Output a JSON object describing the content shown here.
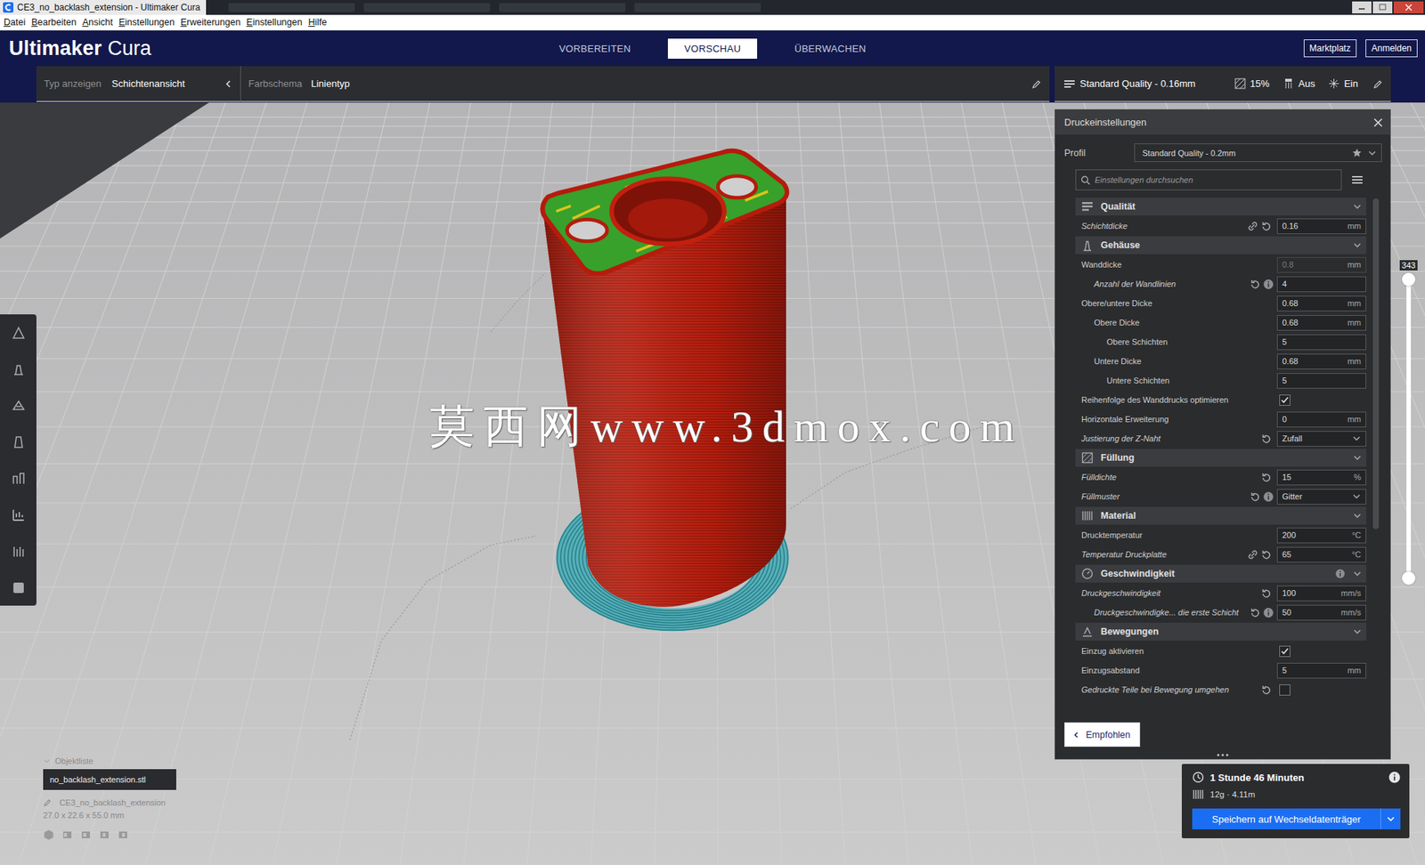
{
  "window": {
    "title": "CE3_no_backlash_extension - Ultimaker Cura"
  },
  "menu": [
    "Datei",
    "Bearbeiten",
    "Ansicht",
    "Einstellungen",
    "Erweiterungen",
    "Einstellungen",
    "Hilfe"
  ],
  "logo": {
    "brand": "Ultimaker",
    "product": "Cura"
  },
  "stages": [
    {
      "label": "VORBEREITEN",
      "selected": false
    },
    {
      "label": "VORSCHAU",
      "selected": true
    },
    {
      "label": "ÜBERWACHEN",
      "selected": false
    }
  ],
  "header_buttons": [
    "Marktplatz",
    "Anmelden"
  ],
  "view_bar": {
    "type_label": "Typ anzeigen",
    "type_value": "Schichtenansicht",
    "scheme_label": "Farbschema",
    "scheme_value": "Linientyp"
  },
  "print_setup": {
    "profile": "Standard Quality - 0.16mm",
    "infill": "15%",
    "support": "Aus",
    "adhesion": "Ein"
  },
  "watermark": "莫西网www.3dmox.com",
  "layer_slider": {
    "value": "343",
    "level": 1
  },
  "settings": {
    "title": "Druckeinstellungen",
    "profile_label": "Profil",
    "profile_value": "Standard Quality - 0.2mm",
    "search_placeholder": "Einstellungen durchsuchen",
    "button": "Empfohlen",
    "rows": [
      {
        "kind": "category",
        "label": "Qualität",
        "expanded": true,
        "info": false
      },
      {
        "kind": "number",
        "label": "Schichtdicke",
        "value": "0.16",
        "unit": "mm",
        "depth": 0,
        "changed": true,
        "linked": true,
        "resettable": true,
        "info": false,
        "disabled": false
      },
      {
        "kind": "category",
        "label": "Gehäuse",
        "expanded": true,
        "info": false
      },
      {
        "kind": "number",
        "label": "Wanddicke",
        "value": "0.8",
        "unit": "mm",
        "depth": 0,
        "changed": false,
        "linked": false,
        "resettable": false,
        "info": false,
        "disabled": true
      },
      {
        "kind": "number",
        "label": "Anzahl der Wandlinien",
        "value": "4",
        "depth": 1,
        "changed": true,
        "linked": false,
        "resettable": true,
        "info": true,
        "disabled": false
      },
      {
        "kind": "number",
        "label": "Obere/untere Dicke",
        "value": "0.68",
        "unit": "mm",
        "depth": 0,
        "changed": false,
        "linked": false,
        "resettable": false,
        "info": false,
        "disabled": false
      },
      {
        "kind": "number",
        "label": "Obere Dicke",
        "value": "0.68",
        "unit": "mm",
        "depth": 1,
        "changed": false,
        "linked": false,
        "resettable": false,
        "info": false,
        "disabled": false
      },
      {
        "kind": "number",
        "label": "Obere Schichten",
        "value": "5",
        "depth": 2,
        "changed": false,
        "linked": false,
        "resettable": false,
        "info": false,
        "disabled": false
      },
      {
        "kind": "number",
        "label": "Untere Dicke",
        "value": "0.68",
        "unit": "mm",
        "depth": 1,
        "changed": false,
        "linked": false,
        "resettable": false,
        "info": false,
        "disabled": false
      },
      {
        "kind": "number",
        "label": "Untere Schichten",
        "value": "5",
        "depth": 2,
        "changed": false,
        "linked": false,
        "resettable": false,
        "info": false,
        "disabled": false
      },
      {
        "kind": "checkbox",
        "label": "Reihenfolge des Wanddrucks optimieren",
        "checked": true,
        "depth": 0,
        "changed": false,
        "linked": false,
        "resettable": false,
        "info": false
      },
      {
        "kind": "number",
        "label": "Horizontale Erweiterung",
        "value": "0",
        "unit": "mm",
        "depth": 0,
        "changed": false,
        "linked": false,
        "resettable": false,
        "info": false,
        "disabled": false
      },
      {
        "kind": "dropdown",
        "label": "Justierung der Z-Naht",
        "value": "Zufall",
        "depth": 0,
        "changed": true,
        "linked": false,
        "resettable": true,
        "info": false
      },
      {
        "kind": "category",
        "label": "Füllung",
        "expanded": true,
        "info": false
      },
      {
        "kind": "number",
        "label": "Fülldichte",
        "value": "15",
        "unit": "%",
        "depth": 0,
        "changed": true,
        "linked": false,
        "resettable": true,
        "info": false,
        "disabled": false
      },
      {
        "kind": "dropdown",
        "label": "Füllmuster",
        "value": "Gitter",
        "depth": 0,
        "changed": true,
        "linked": false,
        "resettable": true,
        "info": true
      },
      {
        "kind": "category",
        "label": "Material",
        "expanded": true,
        "info": false
      },
      {
        "kind": "number",
        "label": "Drucktemperatur",
        "value": "200",
        "unit": "°C",
        "depth": 0,
        "changed": false,
        "linked": false,
        "resettable": false,
        "info": false,
        "disabled": false
      },
      {
        "kind": "number",
        "label": "Temperatur Druckplatte",
        "value": "65",
        "unit": "°C",
        "depth": 0,
        "changed": true,
        "linked": true,
        "resettable": true,
        "info": false,
        "disabled": false
      },
      {
        "kind": "category",
        "label": "Geschwindigkeit",
        "expanded": true,
        "info": true
      },
      {
        "kind": "number",
        "label": "Druckgeschwindigkeit",
        "value": "100",
        "unit": "mm/s",
        "depth": 0,
        "changed": true,
        "linked": false,
        "resettable": true,
        "info": false,
        "disabled": false
      },
      {
        "kind": "number",
        "label": "Druckgeschwindigke... die erste Schicht",
        "value": "50",
        "unit": "mm/s",
        "depth": 1,
        "changed": true,
        "linked": false,
        "resettable": true,
        "info": true,
        "disabled": false
      },
      {
        "kind": "category",
        "label": "Bewegungen",
        "expanded": true,
        "info": false
      },
      {
        "kind": "checkbox",
        "label": "Einzug aktivieren",
        "checked": true,
        "depth": 0,
        "changed": false,
        "linked": false,
        "resettable": false,
        "info": false
      },
      {
        "kind": "number",
        "label": "Einzugsabstand",
        "value": "5",
        "unit": "mm",
        "depth": 0,
        "changed": false,
        "linked": false,
        "resettable": false,
        "info": false,
        "disabled": false
      },
      {
        "kind": "checkbox",
        "label": "Gedruckte Teile bei Bewegung umgehen",
        "checked": false,
        "depth": 0,
        "changed": true,
        "linked": false,
        "resettable": true,
        "info": false
      }
    ]
  },
  "object_list": {
    "title": "Objektliste",
    "items": [
      {
        "name": "no_backlash_extension.stl",
        "selected": true
      }
    ],
    "job_name": "CE3_no_backlash_extension",
    "dimensions": "27.0 x 22.6 x 55.0 mm"
  },
  "estimate": {
    "time": "1 Stunde 46 Minuten",
    "material": "12g · 4.11m",
    "save_button": "Speichern auf Wechseldatenträger"
  }
}
